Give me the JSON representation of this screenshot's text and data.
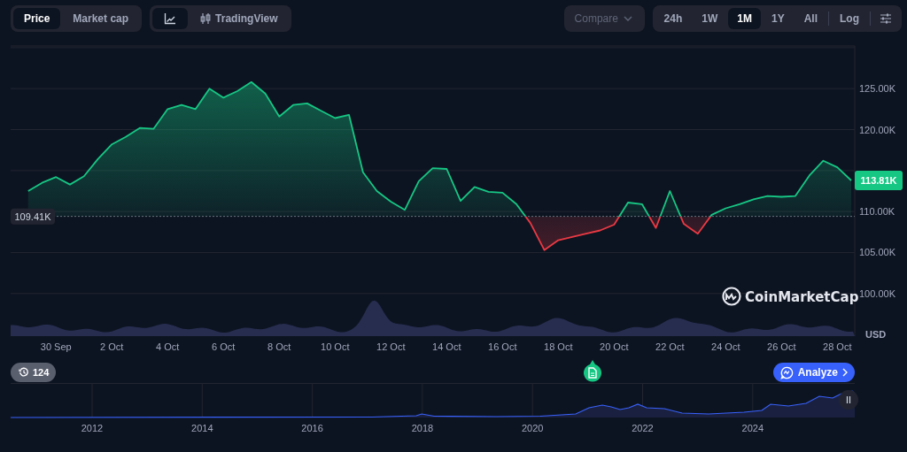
{
  "toolbar": {
    "view_tabs": [
      {
        "label": "Price",
        "selected": true
      },
      {
        "label": "Market cap",
        "selected": false
      }
    ],
    "chart_type_tabs": [
      {
        "kind": "line",
        "selected": true
      },
      {
        "kind": "tradingview",
        "label": "TradingView",
        "selected": false
      }
    ],
    "compare": {
      "label": "Compare",
      "disabled": true
    },
    "ranges": [
      {
        "label": "24h",
        "selected": false
      },
      {
        "label": "1W",
        "selected": false
      },
      {
        "label": "1M",
        "selected": true
      },
      {
        "label": "1Y",
        "selected": false
      },
      {
        "label": "All",
        "selected": false
      }
    ],
    "log": {
      "label": "Log",
      "selected": false
    }
  },
  "price_chart": {
    "currency": "USD",
    "brand": "CoinMarketCap",
    "current_price_label": "113.81K",
    "chart_data": {
      "type": "area",
      "grid": true,
      "ylim": [
        94.8,
        130.2
      ],
      "ref_lines": [
        {
          "axis": "y",
          "value": 109.41,
          "label": "109.41K",
          "color": "#6b7280"
        }
      ],
      "categories": [
        null,
        null,
        null,
        "30 Sep",
        null,
        null,
        null,
        "2 Oct",
        null,
        null,
        null,
        "4 Oct",
        null,
        null,
        null,
        "6 Oct",
        null,
        null,
        null,
        "8 Oct",
        null,
        null,
        null,
        "10 Oct",
        null,
        null,
        null,
        "12 Oct",
        null,
        null,
        null,
        "14 Oct",
        null,
        null,
        null,
        "16 Oct",
        null,
        null,
        null,
        "18 Oct",
        null,
        null,
        null,
        "20 Oct",
        null,
        null,
        null,
        "22 Oct",
        null,
        null,
        null,
        "24 Oct",
        null,
        null,
        null,
        "26 Oct",
        null,
        null,
        null,
        "28 Oct",
        null
      ],
      "series": [
        {
          "color": "#16c784",
          "values": [
            null,
            112.5,
            113.5,
            114.2,
            113.3,
            114.3,
            116.4,
            118.2,
            119.1,
            120.2,
            120.1,
            122.5,
            123.0,
            122.5,
            125.0,
            123.9,
            124.7,
            125.8,
            124.4,
            121.6,
            123.0,
            123.2,
            122.3,
            121.4,
            121.8,
            114.8,
            112.5,
            111.2,
            110.2,
            113.7,
            115.3,
            115.2,
            111.3,
            113.0,
            112.4,
            112.3,
            110.9,
            108.6,
            105.3,
            106.5,
            106.9,
            107.3,
            107.7,
            108.4,
            111.1,
            110.9,
            108.0,
            112.5,
            108.5,
            107.3,
            109.6,
            110.4,
            110.9,
            111.5,
            111.9,
            111.8,
            111.9,
            114.4,
            116.2,
            115.4,
            113.8
          ]
        }
      ],
      "yticks": [
        {
          "value": 100,
          "label": "100.00K"
        },
        {
          "value": 105,
          "label": "105.00K"
        },
        {
          "value": 110,
          "label": "110.00K"
        },
        {
          "value": 120,
          "label": "120.00K"
        },
        {
          "value": 125,
          "label": "125.00K"
        }
      ]
    }
  },
  "markers": {
    "history_count": "124",
    "analyze_label": "Analyze"
  },
  "navigator": {
    "year_labels": [
      "2012",
      "2014",
      "2016",
      "2018",
      "2020",
      "2022",
      "2024"
    ]
  }
}
